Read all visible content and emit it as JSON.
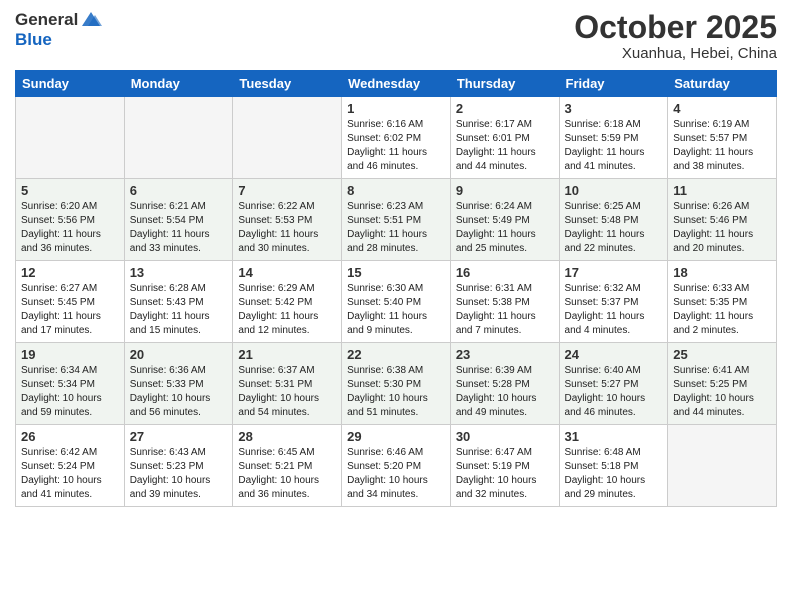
{
  "header": {
    "logo_line1": "General",
    "logo_line2": "Blue",
    "month": "October 2025",
    "location": "Xuanhua, Hebei, China"
  },
  "weekdays": [
    "Sunday",
    "Monday",
    "Tuesday",
    "Wednesday",
    "Thursday",
    "Friday",
    "Saturday"
  ],
  "weeks": [
    [
      {
        "day": "",
        "info": ""
      },
      {
        "day": "",
        "info": ""
      },
      {
        "day": "",
        "info": ""
      },
      {
        "day": "1",
        "info": "Sunrise: 6:16 AM\nSunset: 6:02 PM\nDaylight: 11 hours\nand 46 minutes."
      },
      {
        "day": "2",
        "info": "Sunrise: 6:17 AM\nSunset: 6:01 PM\nDaylight: 11 hours\nand 44 minutes."
      },
      {
        "day": "3",
        "info": "Sunrise: 6:18 AM\nSunset: 5:59 PM\nDaylight: 11 hours\nand 41 minutes."
      },
      {
        "day": "4",
        "info": "Sunrise: 6:19 AM\nSunset: 5:57 PM\nDaylight: 11 hours\nand 38 minutes."
      }
    ],
    [
      {
        "day": "5",
        "info": "Sunrise: 6:20 AM\nSunset: 5:56 PM\nDaylight: 11 hours\nand 36 minutes."
      },
      {
        "day": "6",
        "info": "Sunrise: 6:21 AM\nSunset: 5:54 PM\nDaylight: 11 hours\nand 33 minutes."
      },
      {
        "day": "7",
        "info": "Sunrise: 6:22 AM\nSunset: 5:53 PM\nDaylight: 11 hours\nand 30 minutes."
      },
      {
        "day": "8",
        "info": "Sunrise: 6:23 AM\nSunset: 5:51 PM\nDaylight: 11 hours\nand 28 minutes."
      },
      {
        "day": "9",
        "info": "Sunrise: 6:24 AM\nSunset: 5:49 PM\nDaylight: 11 hours\nand 25 minutes."
      },
      {
        "day": "10",
        "info": "Sunrise: 6:25 AM\nSunset: 5:48 PM\nDaylight: 11 hours\nand 22 minutes."
      },
      {
        "day": "11",
        "info": "Sunrise: 6:26 AM\nSunset: 5:46 PM\nDaylight: 11 hours\nand 20 minutes."
      }
    ],
    [
      {
        "day": "12",
        "info": "Sunrise: 6:27 AM\nSunset: 5:45 PM\nDaylight: 11 hours\nand 17 minutes."
      },
      {
        "day": "13",
        "info": "Sunrise: 6:28 AM\nSunset: 5:43 PM\nDaylight: 11 hours\nand 15 minutes."
      },
      {
        "day": "14",
        "info": "Sunrise: 6:29 AM\nSunset: 5:42 PM\nDaylight: 11 hours\nand 12 minutes."
      },
      {
        "day": "15",
        "info": "Sunrise: 6:30 AM\nSunset: 5:40 PM\nDaylight: 11 hours\nand 9 minutes."
      },
      {
        "day": "16",
        "info": "Sunrise: 6:31 AM\nSunset: 5:38 PM\nDaylight: 11 hours\nand 7 minutes."
      },
      {
        "day": "17",
        "info": "Sunrise: 6:32 AM\nSunset: 5:37 PM\nDaylight: 11 hours\nand 4 minutes."
      },
      {
        "day": "18",
        "info": "Sunrise: 6:33 AM\nSunset: 5:35 PM\nDaylight: 11 hours\nand 2 minutes."
      }
    ],
    [
      {
        "day": "19",
        "info": "Sunrise: 6:34 AM\nSunset: 5:34 PM\nDaylight: 10 hours\nand 59 minutes."
      },
      {
        "day": "20",
        "info": "Sunrise: 6:36 AM\nSunset: 5:33 PM\nDaylight: 10 hours\nand 56 minutes."
      },
      {
        "day": "21",
        "info": "Sunrise: 6:37 AM\nSunset: 5:31 PM\nDaylight: 10 hours\nand 54 minutes."
      },
      {
        "day": "22",
        "info": "Sunrise: 6:38 AM\nSunset: 5:30 PM\nDaylight: 10 hours\nand 51 minutes."
      },
      {
        "day": "23",
        "info": "Sunrise: 6:39 AM\nSunset: 5:28 PM\nDaylight: 10 hours\nand 49 minutes."
      },
      {
        "day": "24",
        "info": "Sunrise: 6:40 AM\nSunset: 5:27 PM\nDaylight: 10 hours\nand 46 minutes."
      },
      {
        "day": "25",
        "info": "Sunrise: 6:41 AM\nSunset: 5:25 PM\nDaylight: 10 hours\nand 44 minutes."
      }
    ],
    [
      {
        "day": "26",
        "info": "Sunrise: 6:42 AM\nSunset: 5:24 PM\nDaylight: 10 hours\nand 41 minutes."
      },
      {
        "day": "27",
        "info": "Sunrise: 6:43 AM\nSunset: 5:23 PM\nDaylight: 10 hours\nand 39 minutes."
      },
      {
        "day": "28",
        "info": "Sunrise: 6:45 AM\nSunset: 5:21 PM\nDaylight: 10 hours\nand 36 minutes."
      },
      {
        "day": "29",
        "info": "Sunrise: 6:46 AM\nSunset: 5:20 PM\nDaylight: 10 hours\nand 34 minutes."
      },
      {
        "day": "30",
        "info": "Sunrise: 6:47 AM\nSunset: 5:19 PM\nDaylight: 10 hours\nand 32 minutes."
      },
      {
        "day": "31",
        "info": "Sunrise: 6:48 AM\nSunset: 5:18 PM\nDaylight: 10 hours\nand 29 minutes."
      },
      {
        "day": "",
        "info": ""
      }
    ]
  ]
}
